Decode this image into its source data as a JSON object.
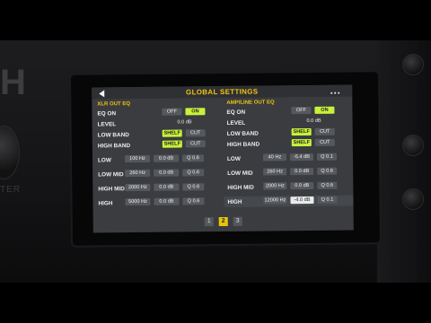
{
  "header": {
    "title": "GLOBAL SETTINGS"
  },
  "xlr": {
    "section": "XLR OUT EQ",
    "eq_on": {
      "label": "EQ ON",
      "off": "OFF",
      "on": "ON"
    },
    "level": {
      "label": "LEVEL",
      "value": "0.0 dB"
    },
    "low_band": {
      "label": "LOW BAND",
      "shelf": "SHELF",
      "cut": "CUT"
    },
    "high_band": {
      "label": "HIGH BAND",
      "shelf": "SHELF",
      "cut": "CUT"
    },
    "bands": [
      {
        "label": "LOW",
        "freq": "100 Hz",
        "gain": "0.0 dB",
        "q": "Q 0.6"
      },
      {
        "label": "LOW MID",
        "freq": "260 Hz",
        "gain": "0.0 dB",
        "q": "Q 0.6"
      },
      {
        "label": "HIGH MID",
        "freq": "2000 Hz",
        "gain": "0.0 dB",
        "q": "Q 0.6"
      },
      {
        "label": "HIGH",
        "freq": "5000 Hz",
        "gain": "0.0 dB",
        "q": "Q 0.6"
      }
    ]
  },
  "amp": {
    "section": "AMP/LINE OUT EQ",
    "eq_on": {
      "label": "EQ ON",
      "off": "OFF",
      "on": "ON"
    },
    "level": {
      "label": "LEVEL",
      "value": "0.0 dB"
    },
    "low_band": {
      "label": "LOW BAND",
      "shelf": "SHELF",
      "cut": "CUT"
    },
    "high_band": {
      "label": "HIGH BAND",
      "shelf": "SHELF",
      "cut": "CUT"
    },
    "bands": [
      {
        "label": "LOW",
        "freq": "40 Hz",
        "gain": "-5.4 dB",
        "q": "Q 0.1"
      },
      {
        "label": "LOW MID",
        "freq": "260 Hz",
        "gain": "0.0 dB",
        "q": "Q 0.6"
      },
      {
        "label": "HIGH MID",
        "freq": "2000 Hz",
        "gain": "0.0 dB",
        "q": "Q 0.6"
      },
      {
        "label": "HIGH",
        "freq": "12000 Hz",
        "gain": "-4.0 dB",
        "q": "Q 0.1"
      }
    ]
  },
  "pager": {
    "pages": [
      "1",
      "2",
      "3"
    ],
    "active": "2"
  },
  "colors": {
    "accent": "#f0c30e",
    "toggle_on": "#c8f23a",
    "screen_bg": "#3a3c40"
  }
}
